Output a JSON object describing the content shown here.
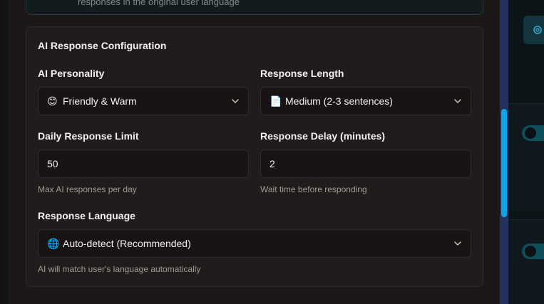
{
  "top_card": {
    "text": "responses in the original user language"
  },
  "section": {
    "title": "AI Response Configuration"
  },
  "personality": {
    "label": "AI Personality",
    "emoji": "😊",
    "value": "Friendly & Warm"
  },
  "response_length": {
    "label": "Response Length",
    "emoji": "📄",
    "value": "Medium (2-3 sentences)"
  },
  "daily_limit": {
    "label": "Daily Response Limit",
    "value": "50",
    "hint": "Max AI responses per day"
  },
  "response_delay": {
    "label": "Response Delay (minutes)",
    "value": "2",
    "hint": "Wait time before responding"
  },
  "language": {
    "label": "Response Language",
    "emoji": "🌐",
    "value": "Auto-detect (Recommended)",
    "hint": "AI will match user's language automatically"
  },
  "colors": {
    "accent": "#0ea5e9",
    "card_bg": "#1f1c1b",
    "input_bg": "#171413",
    "border": "#2f2b2a"
  },
  "icons": {
    "chevron": "chevron-down-icon",
    "gear": "gear-icon"
  }
}
